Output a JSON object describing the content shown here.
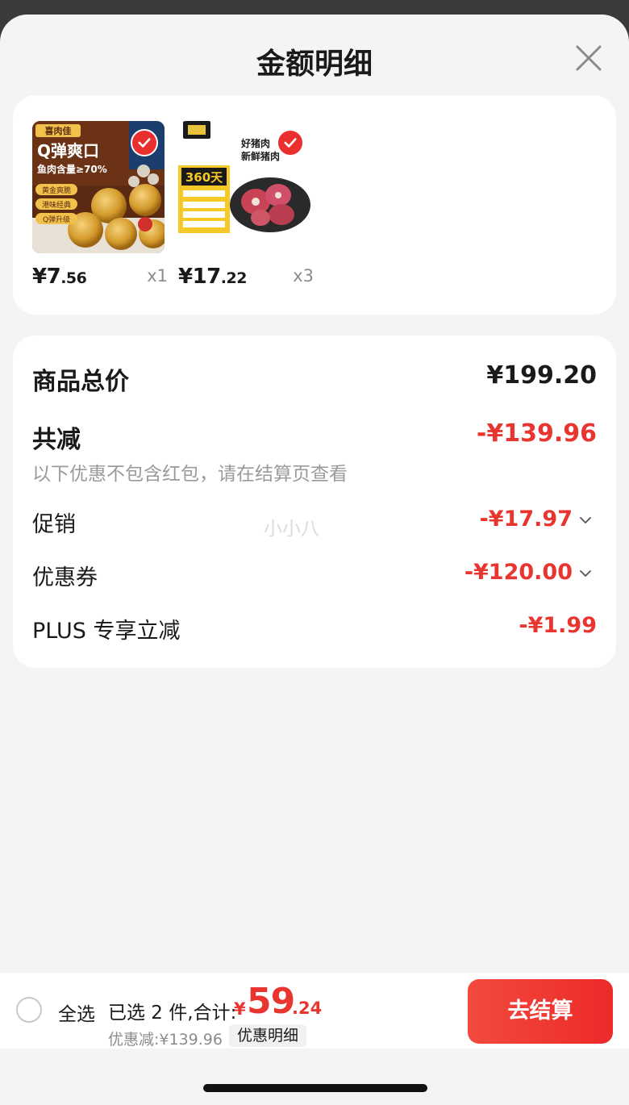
{
  "sheet": {
    "title": "金额明细"
  },
  "products": [
    {
      "price_int": "¥7",
      "price_dec": ".56",
      "qty": "x1",
      "image": {
        "brand_label": "喜肉佳",
        "headline": "Q弹爽口",
        "subline": "鱼肉含量≥70%",
        "tags": [
          "黄金爽脆",
          "港味经典",
          "Q弹升级"
        ]
      }
    },
    {
      "price_int": "¥17",
      "price_dec": ".22",
      "qty": "x3",
      "image": {
        "headline_top": "好猪肉",
        "headline_bottom": "新鲜猪肉",
        "badge": "360天"
      }
    }
  ],
  "breakdown": {
    "total_label": "商品总价",
    "total_value": "¥199.20",
    "reduction_label": "共减",
    "reduction_value": "-¥139.96",
    "note": "以下优惠不包含红包，请在结算页查看",
    "items": [
      {
        "label": "促销",
        "value": "-¥17.97",
        "expandable": true
      },
      {
        "label": "优惠券",
        "value": "-¥120.00",
        "expandable": true
      },
      {
        "label": "PLUS 专享立减",
        "value": "-¥1.99",
        "expandable": false
      }
    ]
  },
  "watermark": "小小八",
  "bottom_bar": {
    "select_all": "全选",
    "selected_summary": "已选 2 件,合计:",
    "total_yen": "¥",
    "total_int": "59",
    "total_dec": ".24",
    "discount_line": "优惠减:¥139.96",
    "discount_detail": "优惠明细",
    "checkout": "去结算"
  },
  "colors": {
    "accent_red": "#e8352f",
    "sheet_bg": "#f4f4f4",
    "card_bg": "#ffffff"
  },
  "icons": {
    "close": "close-icon",
    "check": "check-badge-icon",
    "expand": "chevron-down-icon"
  }
}
